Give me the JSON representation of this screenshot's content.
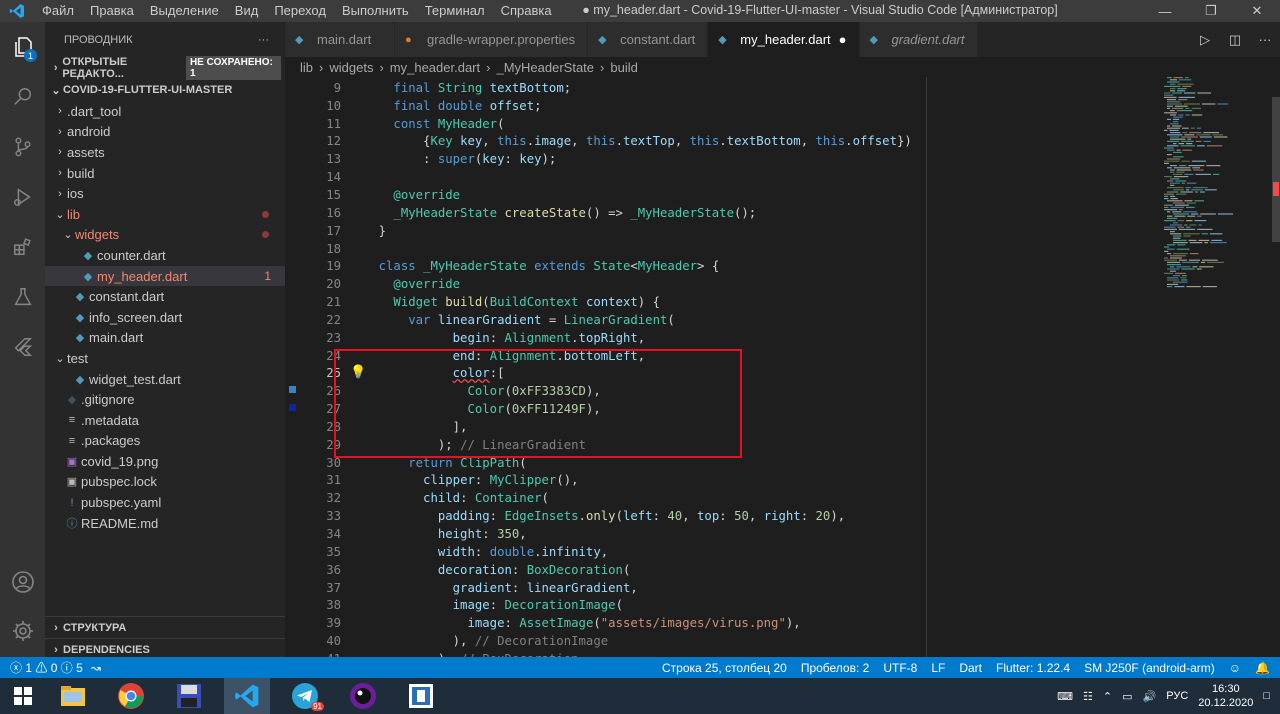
{
  "window": {
    "title": "● my_header.dart - Covid-19-Flutter-UI-master - Visual Studio Code [Администратор]",
    "menu": [
      "Файл",
      "Правка",
      "Выделение",
      "Вид",
      "Переход",
      "Выполнить",
      "Терминал",
      "Справка"
    ]
  },
  "activity_bar": {
    "explorer_badge": "1"
  },
  "sidebar": {
    "title": "ПРОВОДНИК",
    "more": "···",
    "open_editors": "ОТКРЫТЫЕ РЕДАКТО...",
    "unsaved_badge": "НЕ СОХРАНЕНО: 1",
    "project": "COVID-19-FLUTTER-UI-MASTER",
    "tree": [
      {
        "label": ".dart_tool",
        "type": "folder",
        "depth": 1,
        "open": false,
        "state": "normal"
      },
      {
        "label": "android",
        "type": "folder",
        "depth": 1,
        "open": false,
        "state": "normal"
      },
      {
        "label": "assets",
        "type": "folder",
        "depth": 1,
        "open": false,
        "state": "normal"
      },
      {
        "label": "build",
        "type": "folder",
        "depth": 1,
        "open": false,
        "state": "normal"
      },
      {
        "label": "ios",
        "type": "folder",
        "depth": 1,
        "open": false,
        "state": "normal"
      },
      {
        "label": "lib",
        "type": "folder",
        "depth": 1,
        "open": true,
        "state": "err"
      },
      {
        "label": "widgets",
        "type": "folder",
        "depth": 2,
        "open": true,
        "state": "err"
      },
      {
        "label": "counter.dart",
        "type": "dart",
        "depth": 3,
        "state": "normal"
      },
      {
        "label": "my_header.dart",
        "type": "dart",
        "depth": 3,
        "state": "err",
        "count": "1",
        "selected": true
      },
      {
        "label": "constant.dart",
        "type": "dart",
        "depth": 2,
        "state": "normal"
      },
      {
        "label": "info_screen.dart",
        "type": "dart",
        "depth": 2,
        "state": "normal"
      },
      {
        "label": "main.dart",
        "type": "dart",
        "depth": 2,
        "state": "normal"
      },
      {
        "label": "test",
        "type": "folder",
        "depth": 1,
        "open": true,
        "state": "normal"
      },
      {
        "label": "widget_test.dart",
        "type": "dart",
        "depth": 2,
        "state": "normal"
      },
      {
        "label": ".gitignore",
        "type": "git",
        "depth": 1,
        "state": "normal"
      },
      {
        "label": ".metadata",
        "type": "text",
        "depth": 1,
        "state": "normal"
      },
      {
        "label": ".packages",
        "type": "text",
        "depth": 1,
        "state": "normal"
      },
      {
        "label": "covid_19.png",
        "type": "image",
        "depth": 1,
        "state": "normal"
      },
      {
        "label": "pubspec.lock",
        "type": "lock",
        "depth": 1,
        "state": "normal"
      },
      {
        "label": "pubspec.yaml",
        "type": "yaml",
        "depth": 1,
        "state": "normal"
      },
      {
        "label": "README.md",
        "type": "info",
        "depth": 1,
        "state": "normal"
      }
    ],
    "outline": "СТРУКТУРА",
    "dependencies": "DEPENDENCIES"
  },
  "tabs": [
    {
      "label": "main.dart",
      "active": false
    },
    {
      "label": "gradle-wrapper.properties",
      "active": false
    },
    {
      "label": "constant.dart",
      "active": false
    },
    {
      "label": "my_header.dart",
      "active": true
    },
    {
      "label": "gradient.dart",
      "active": false
    }
  ],
  "breadcrumb": [
    "lib",
    "widgets",
    "my_header.dart",
    "_MyHeaderState",
    "build"
  ],
  "code": {
    "current_line": 25,
    "lines": [
      {
        "n": "9",
        "html": "  <span class='k'>final</span> <span class='c'>String</span> <span class='v'>textBottom</span>;"
      },
      {
        "n": "10",
        "html": "  <span class='k'>final</span> <span class='k'>double</span> <span class='v'>offset</span>;"
      },
      {
        "n": "11",
        "html": "  <span class='k'>const</span> <span class='c'>MyHeader</span>("
      },
      {
        "n": "12",
        "html": "      {<span class='c'>Key</span> <span class='v'>key</span>, <span class='k'>this</span>.<span class='v'>image</span>, <span class='k'>this</span>.<span class='v'>textTop</span>, <span class='k'>this</span>.<span class='v'>textBottom</span>, <span class='k'>this</span>.<span class='v'>offset</span>})"
      },
      {
        "n": "13",
        "html": "      : <span class='k'>super</span>(<span class='v'>key</span>: <span class='v'>key</span>);"
      },
      {
        "n": "14",
        "html": ""
      },
      {
        "n": "15",
        "html": "  <span class='c'>@override</span>"
      },
      {
        "n": "16",
        "html": "  <span class='c'>_MyHeaderState</span> <span class='f'>createState</span>() => <span class='c'>_MyHeaderState</span>();"
      },
      {
        "n": "17",
        "html": "}"
      },
      {
        "n": "18",
        "html": ""
      },
      {
        "n": "19",
        "html": "<span class='k'>class</span> <span class='c'>_MyHeaderState</span> <span class='k'>extends</span> <span class='c'>State</span>&lt;<span class='c'>MyHeader</span>&gt; {"
      },
      {
        "n": "20",
        "html": "  <span class='c'>@override</span>"
      },
      {
        "n": "21",
        "html": "  <span class='c'>Widget</span> <span class='f'>build</span>(<span class='c'>BuildContext</span> <span class='v'>context</span>) {"
      },
      {
        "n": "22",
        "html": "    <span class='k'>var</span> <span class='v'>linearGradient</span> = <span class='c'>LinearGradient</span>("
      },
      {
        "n": "23",
        "html": "          <span class='v'>begin</span>: <span class='c'>Alignment</span>.<span class='v'>topRight</span>,"
      },
      {
        "n": "24",
        "html": "          <span class='v'>end</span>: <span class='c'>Alignment</span>.<span class='v'>bottomLeft</span>,"
      },
      {
        "n": "25",
        "html": "          <span class='v' style='text-decoration:underline wavy #f14c4c'>color</span>:["
      },
      {
        "n": "26",
        "html": "            <span class='c'>Color</span>(<span class='n'>0xFF3383CD</span>),"
      },
      {
        "n": "27",
        "html": "            <span class='c'>Color</span>(<span class='n'>0xFF11249F</span>),"
      },
      {
        "n": "28",
        "html": "          ],"
      },
      {
        "n": "29",
        "html": "        ); <span class='cg'>// LinearGradient</span>"
      },
      {
        "n": "30",
        "html": "    <span class='k'>return</span> <span class='c'>ClipPath</span>("
      },
      {
        "n": "31",
        "html": "      <span class='v'>clipper</span>: <span class='c'>MyClipper</span>(),"
      },
      {
        "n": "32",
        "html": "      <span class='v'>child</span>: <span class='c'>Container</span>("
      },
      {
        "n": "33",
        "html": "        <span class='v'>padding</span>: <span class='c'>EdgeInsets</span>.<span class='f'>only</span>(<span class='v'>left</span>: <span class='n'>40</span>, <span class='v'>top</span>: <span class='n'>50</span>, <span class='v'>right</span>: <span class='n'>20</span>),"
      },
      {
        "n": "34",
        "html": "        <span class='v'>height</span>: <span class='n'>350</span>,"
      },
      {
        "n": "35",
        "html": "        <span class='v'>width</span>: <span class='k'>double</span>.<span class='v'>infinity</span>,"
      },
      {
        "n": "36",
        "html": "        <span class='v'>decoration</span>: <span class='c'>BoxDecoration</span>("
      },
      {
        "n": "37",
        "html": "          <span class='v'>gradient</span>: <span class='v'>linearGradient</span>,"
      },
      {
        "n": "38",
        "html": "          <span class='v'>image</span>: <span class='c'>DecorationImage</span>("
      },
      {
        "n": "39",
        "html": "            <span class='v'>image</span>: <span class='c'>AssetImage</span>(<span class='s'>\"assets/images/virus.png\"</span>),"
      },
      {
        "n": "40",
        "html": "          ), <span class='cg'>// DecorationImage</span>"
      },
      {
        "n": "41",
        "html": "        ), <span class='cg'>// BoxDecoration</span>"
      }
    ]
  },
  "statusbar": {
    "errors": "1",
    "warnings": "0",
    "info": "5",
    "position": "Строка 25, столбец 20",
    "spaces": "Пробелов: 2",
    "encoding": "UTF-8",
    "eol": "LF",
    "language": "Dart",
    "flutter": "Flutter: 1.22.4",
    "device": "SM J250F (android-arm)"
  },
  "taskbar": {
    "apps": [
      "file-explorer",
      "chrome",
      "save-disk",
      "vscode",
      "telegram",
      "mpc",
      "terminal"
    ],
    "telegram_badge": "91",
    "lang": "РУС",
    "time": "16:30",
    "date": "20.12.2020"
  },
  "colors": {
    "accent": "#007acc",
    "highlight_box": "#e81123",
    "color_swatch_1": "#3383cd",
    "color_swatch_2": "#11249f"
  }
}
